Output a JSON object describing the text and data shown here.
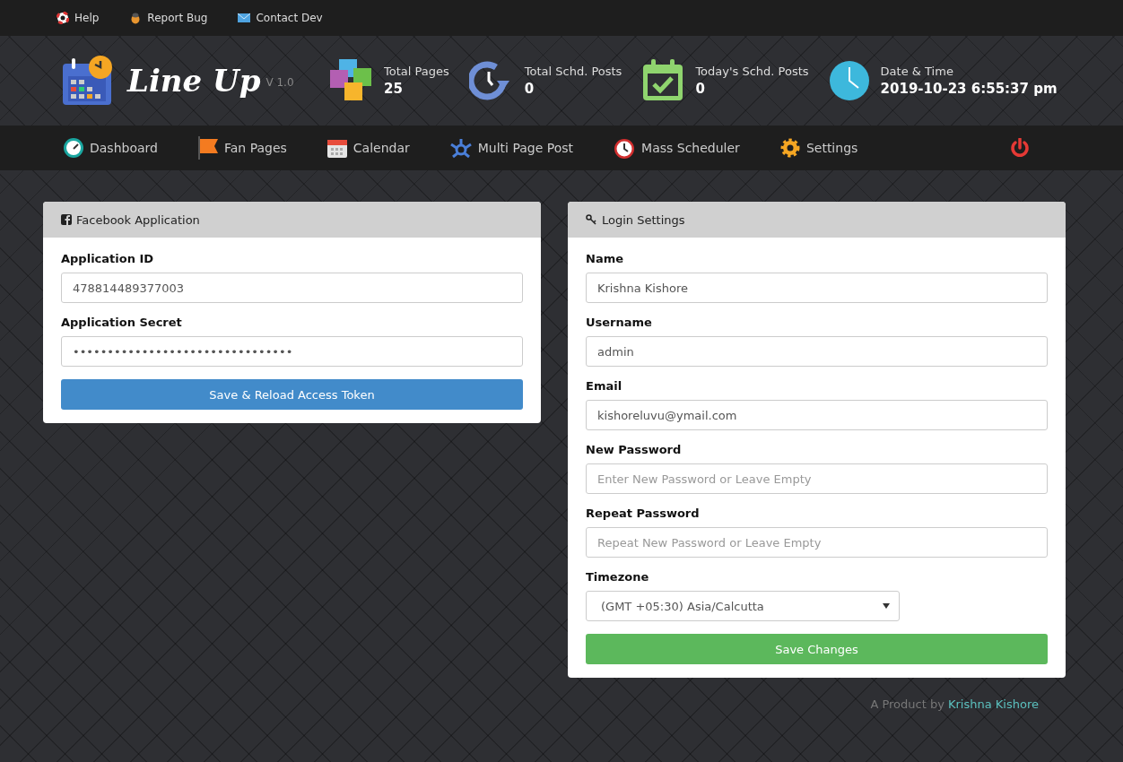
{
  "top_links": [
    {
      "label": "Help"
    },
    {
      "label": "Report Bug"
    },
    {
      "label": "Contact Dev"
    }
  ],
  "brand": {
    "name": "Line Up",
    "version": "V 1.0"
  },
  "stats": [
    {
      "label": "Total Pages",
      "value": "25"
    },
    {
      "label": "Total Schd. Posts",
      "value": "0"
    },
    {
      "label": "Today's Schd. Posts",
      "value": "0"
    },
    {
      "label": "Date & Time",
      "value": "2019-10-23 6:55:37 pm"
    }
  ],
  "nav": [
    {
      "label": "Dashboard"
    },
    {
      "label": "Fan Pages"
    },
    {
      "label": "Calendar"
    },
    {
      "label": "Multi Page Post"
    },
    {
      "label": "Mass Scheduler"
    },
    {
      "label": "Settings"
    }
  ],
  "panels": [
    {
      "title": "Facebook Application",
      "fields": [
        {
          "kind": "text",
          "label": "Application ID",
          "value": "478814489377003"
        },
        {
          "kind": "text",
          "label": "Application Secret",
          "value": "••••••••••••••••••••••••••••••••"
        }
      ],
      "button": {
        "label": "Save & Reload Access Token",
        "kind": "primary"
      }
    },
    {
      "title": "Login Settings",
      "fields": [
        {
          "kind": "text",
          "label": "Name",
          "value": "Krishna Kishore"
        },
        {
          "kind": "text",
          "label": "Username",
          "value": "admin"
        },
        {
          "kind": "text",
          "label": "Email",
          "value": "kishoreluvu@ymail.com"
        },
        {
          "kind": "text",
          "label": "New Password",
          "placeholder": "Enter New Password or Leave Empty"
        },
        {
          "kind": "text",
          "label": "Repeat Password",
          "placeholder": "Repeat New Password or Leave Empty"
        },
        {
          "kind": "select",
          "label": "Timezone",
          "value": "(GMT +05:30) Asia/Calcutta"
        }
      ],
      "button": {
        "label": "Save Changes",
        "kind": "success"
      }
    }
  ],
  "footer": {
    "text": "A Product by",
    "link": "Krishna Kishore"
  }
}
